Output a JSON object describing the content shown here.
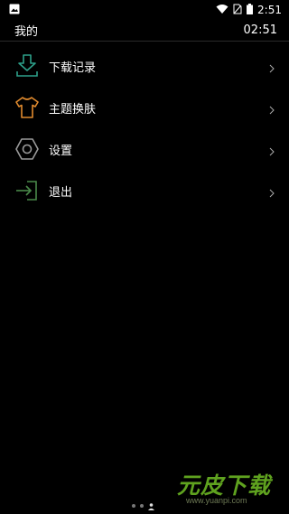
{
  "status_bar": {
    "time": "2:51",
    "icons": [
      "image-icon",
      "wifi-icon",
      "sim-icon",
      "battery-icon"
    ]
  },
  "header": {
    "title": "我的",
    "time": "02:51"
  },
  "menu": {
    "items": [
      {
        "label": "下载记录",
        "icon": "download-icon",
        "color": "#2ea08a"
      },
      {
        "label": "主题换肤",
        "icon": "tshirt-icon",
        "color": "#e08a2e"
      },
      {
        "label": "设置",
        "icon": "settings-icon",
        "color": "#9a9a9a"
      },
      {
        "label": "退出",
        "icon": "logout-icon",
        "color": "#4a8a4a"
      }
    ]
  },
  "pager": {
    "count": 3,
    "active": 2
  },
  "watermark": {
    "title": "元皮下载",
    "url": "www.yuanpi.com"
  }
}
